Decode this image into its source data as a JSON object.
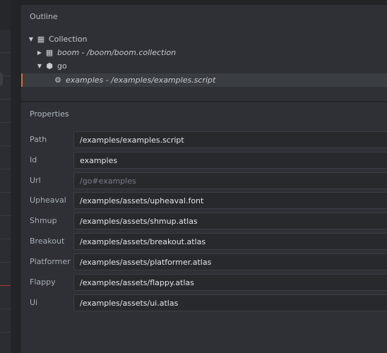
{
  "outline": {
    "title": "Outline",
    "items": [
      {
        "label": "Collection",
        "icon": "collection-icon",
        "expanded": true,
        "italic": false
      },
      {
        "label": "boom - /boom/boom.collection",
        "icon": "collection-icon",
        "expanded": false,
        "italic": true
      },
      {
        "label": "go",
        "icon": "game-object-icon",
        "expanded": true,
        "italic": false
      },
      {
        "label": "examples - /examples/examples.script",
        "icon": "script-gear-icon",
        "italic": true,
        "selected": true
      }
    ]
  },
  "properties": {
    "title": "Properties",
    "rows": [
      {
        "label": "Path",
        "value": "/examples/examples.script"
      },
      {
        "label": "Id",
        "value": "examples"
      },
      {
        "label": "Url",
        "value": "/go#examples",
        "readonly": true
      },
      {
        "label": "Upheaval",
        "value": "/examples/assets/upheaval.font"
      },
      {
        "label": "Shmup",
        "value": "/examples/assets/shmup.atlas"
      },
      {
        "label": "Breakout",
        "value": "/examples/assets/breakout.atlas"
      },
      {
        "label": "Platformer",
        "value": "/examples/assets/platformer.atlas"
      },
      {
        "label": "Flappy",
        "value": "/examples/assets/flappy.atlas"
      },
      {
        "label": "Ui",
        "value": "/examples/assets/ui.atlas"
      }
    ]
  },
  "colors": {
    "selection_accent": "#e2692c",
    "panel_bg": "#2e3035",
    "field_bg": "#27292d"
  }
}
